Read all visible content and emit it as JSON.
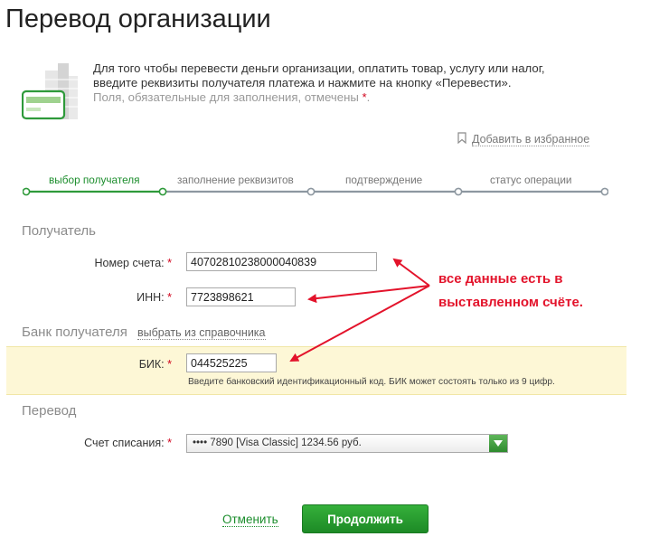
{
  "page": {
    "title": "Перевод организации"
  },
  "intro": {
    "line1": "Для того чтобы перевести деньги организации, оплатить товар, услугу или налог,",
    "line2": "введите реквизиты получателя платежа и нажмите на кнопку «Перевести».",
    "required_note": "Поля, обязательные для заполнения, отмечены",
    "required_mark": "*",
    "required_end": "."
  },
  "favorites": {
    "label": "Добавить в избранное",
    "icon": "bookmark-icon"
  },
  "steps": [
    {
      "label": "выбор получателя",
      "active": true
    },
    {
      "label": "заполнение реквизитов",
      "active": false
    },
    {
      "label": "подтверждение",
      "active": false
    },
    {
      "label": "статус операции",
      "active": false
    }
  ],
  "recipient": {
    "heading": "Получатель",
    "account_label": "Номер счета:",
    "account_value": "40702810238000040839",
    "inn_label": "ИНН:",
    "inn_value": "7723898621"
  },
  "bank": {
    "heading": "Банк получателя",
    "dictionary_link": "выбрать из справочника",
    "bik_label": "БИК:",
    "bik_value": "044525225",
    "bik_hint": "Введите банковский идентификационный код. БИК может состоять только из 9 цифр."
  },
  "transfer": {
    "heading": "Перевод",
    "debit_label": "Счет списания:",
    "debit_value": "•••• 7890  [Visa Classic]  1234.56 руб."
  },
  "annotation": {
    "line1": "все данные есть в",
    "line2": "выставленном счёте."
  },
  "actions": {
    "cancel": "Отменить",
    "continue": "Продолжить"
  },
  "colors": {
    "accent_green": "#1b8d2c",
    "required_red": "#d0021b",
    "annotation_red": "#e3132b",
    "highlight_band": "#fdf7d6"
  }
}
